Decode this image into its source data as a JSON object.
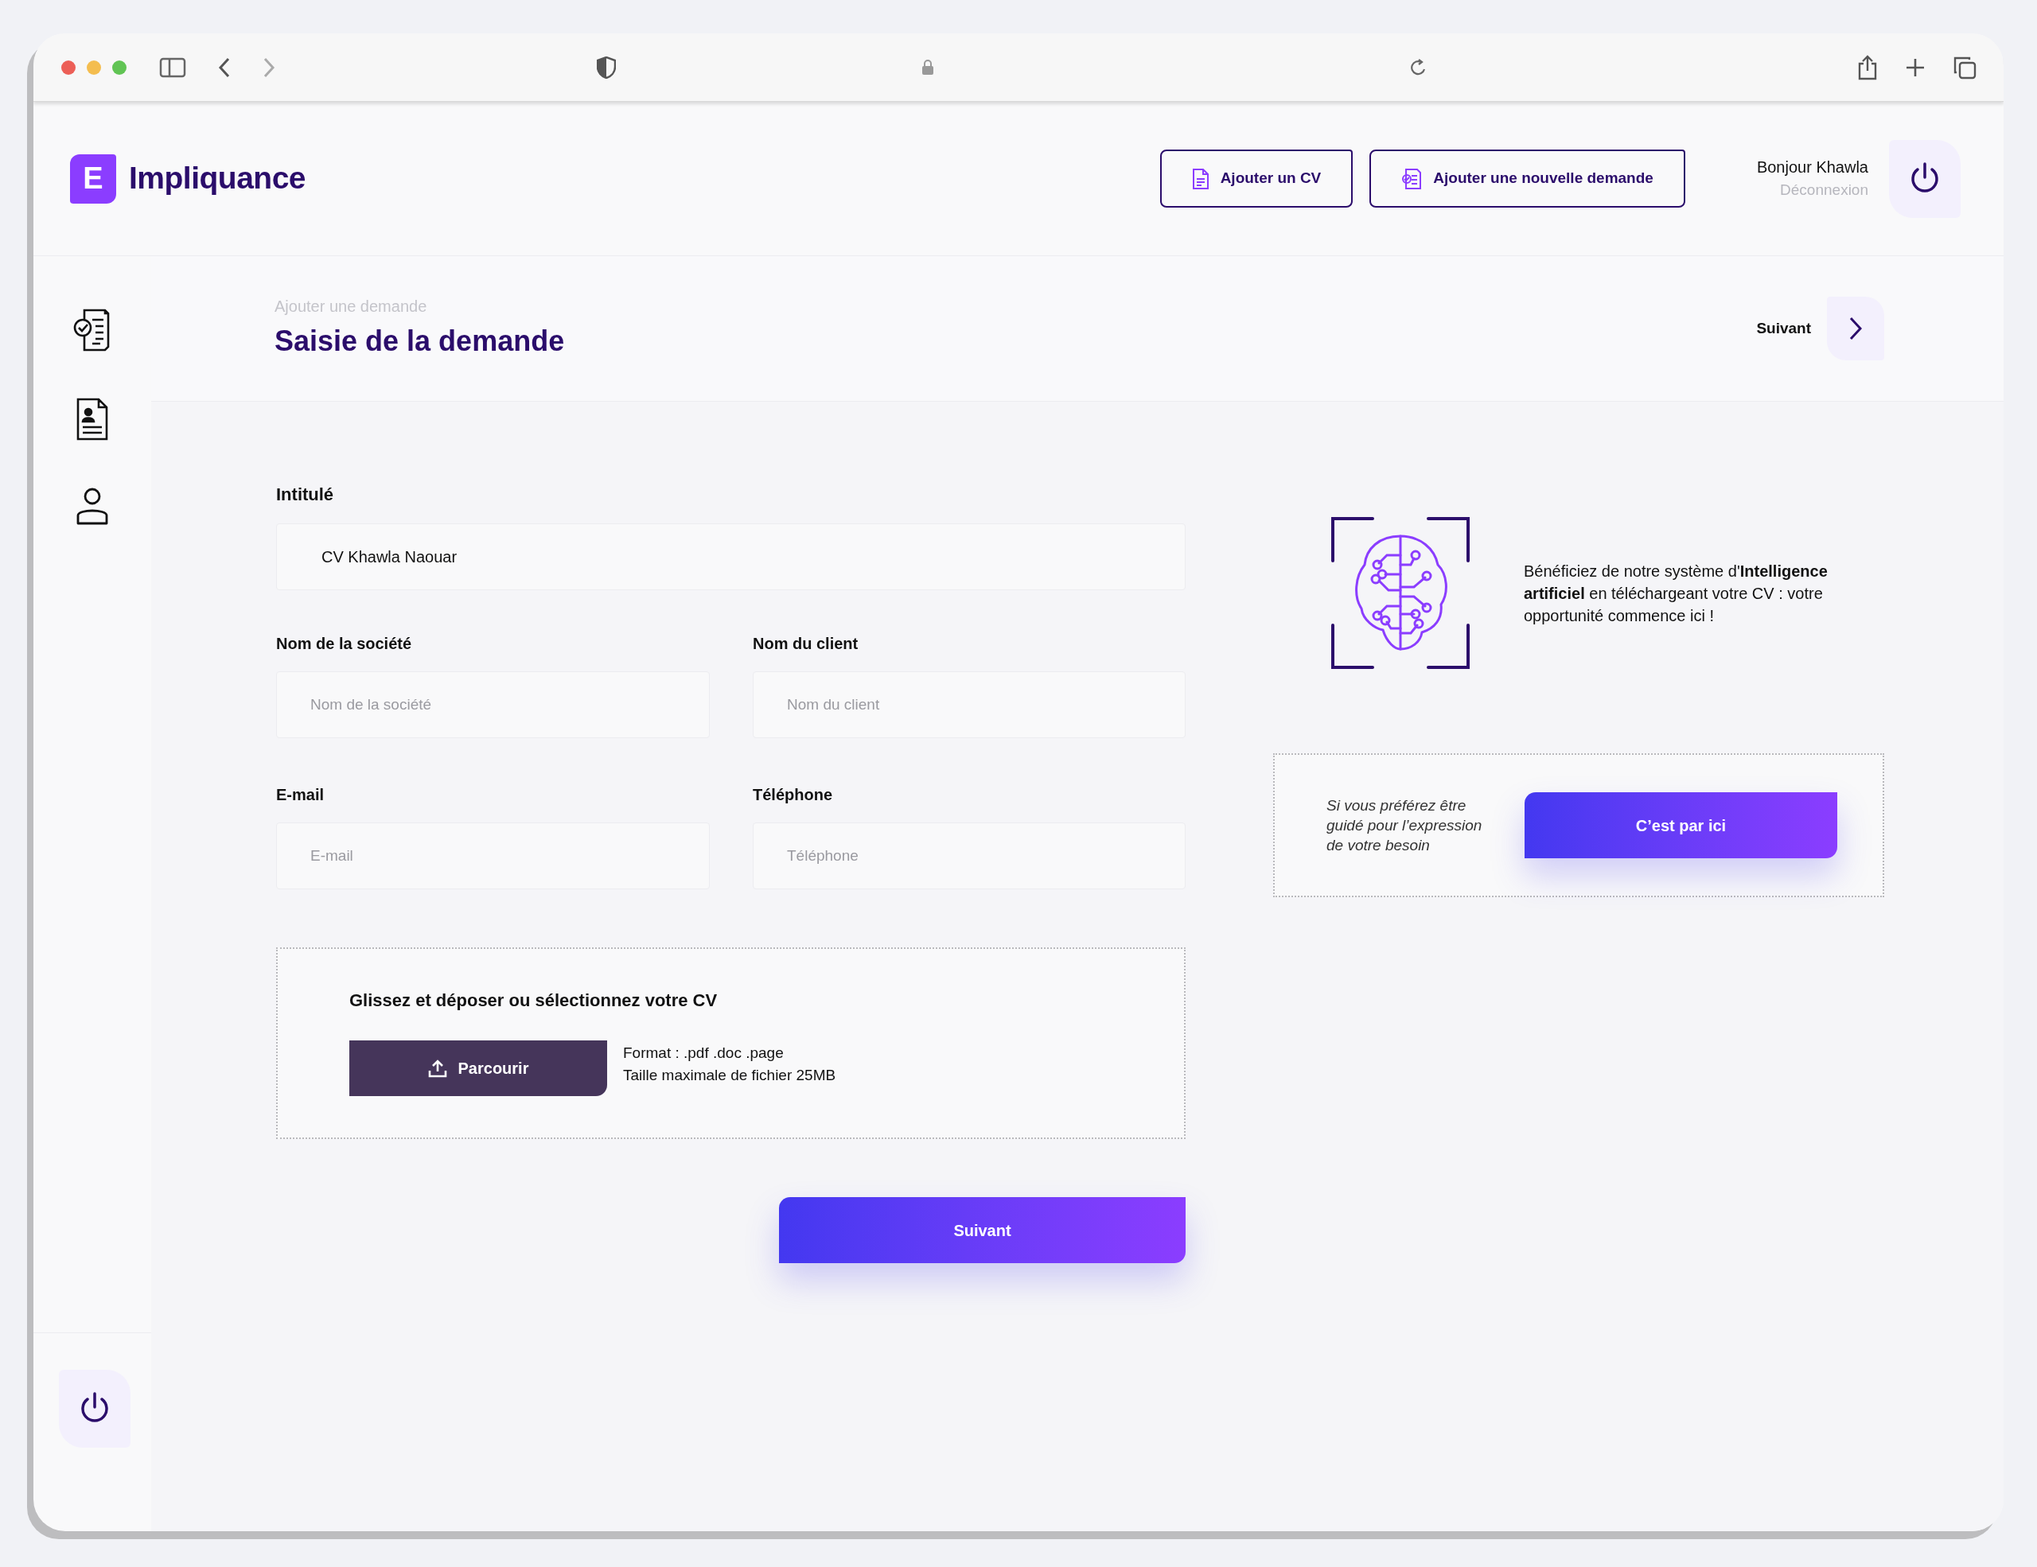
{
  "app": {
    "logo": {
      "letter": "E",
      "name": "Impliquance"
    },
    "header_buttons": [
      {
        "kind": "cv",
        "label": "Ajouter un CV"
      },
      {
        "kind": "request",
        "label": "Ajouter une nouvelle demande"
      }
    ],
    "user": {
      "greeting": "Bonjour Khawla",
      "logout": "Déconnexion"
    }
  },
  "sidebar": {
    "items": [
      {
        "kind": "checklist"
      },
      {
        "kind": "profile-document"
      },
      {
        "kind": "user"
      }
    ]
  },
  "page_header": {
    "breadcrumb": "Ajouter une demande",
    "title": "Saisie de la demande",
    "next": "Suivant"
  },
  "form": {
    "title_field": {
      "label": "Intitulé",
      "value": "CV Khawla Naouar"
    },
    "fields": [
      {
        "label": "Nom de la société",
        "placeholder": "Nom de la société"
      },
      {
        "label": "Nom du client",
        "placeholder": "Nom du client"
      },
      {
        "label": "E-mail",
        "placeholder": "E-mail"
      },
      {
        "label": "Téléphone",
        "placeholder": "Téléphone"
      }
    ],
    "upload": {
      "heading": "Glissez et déposer ou sélectionnez votre CV",
      "button": "Parcourir",
      "lines": [
        "Format : .pdf .doc .page",
        "Taille maximale de fichier 25MB"
      ]
    },
    "submit": "Suivant"
  },
  "ai_promo": {
    "text": "Bénéficiez de notre système d'**Intelligence artificiel** en téléchargeant votre CV : votre opportunité commence ici !"
  },
  "guided": {
    "text": "Si vous préférez être guidé pour l’expression de votre besoin",
    "button": "C’est par ici"
  }
}
